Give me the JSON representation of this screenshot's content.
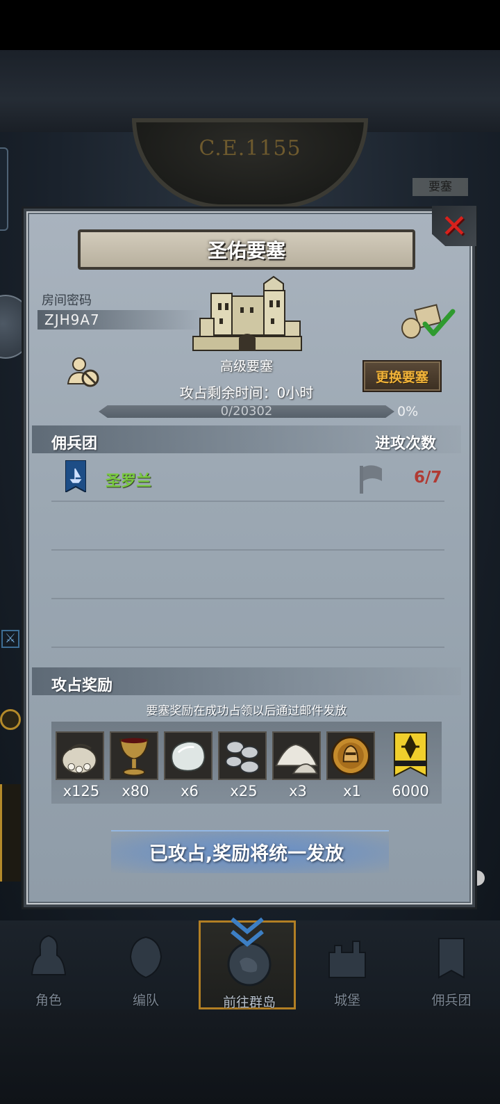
{
  "background": {
    "era": "C.E.1155",
    "map_label": "要塞"
  },
  "panel": {
    "title": "圣佑要塞",
    "room_code_label": "房间密码",
    "room_code": "ZJH9A7",
    "fortress_type": "高级要塞",
    "change_button": "更换要塞",
    "remaining_time": "攻占剩余时间：0小时",
    "progress": {
      "text": "0/20302",
      "percent_label": "0%",
      "value": 0
    }
  },
  "mercenary": {
    "header": "佣兵团",
    "attack_header": "进攻次数",
    "rows": [
      {
        "name": "圣罗兰",
        "attacks": "6/7"
      }
    ]
  },
  "rewards": {
    "header": "攻占奖励",
    "note": "要塞奖励在成功占领以后通过邮件发放",
    "items": [
      {
        "icon": "coin-sack-icon",
        "qty": "x125"
      },
      {
        "icon": "goblet-icon",
        "qty": "x80"
      },
      {
        "icon": "gem-stone-icon",
        "qty": "x6"
      },
      {
        "icon": "silver-ore-icon",
        "qty": "x25"
      },
      {
        "icon": "salt-pile-icon",
        "qty": "x3"
      },
      {
        "icon": "knight-medal-icon",
        "qty": "x1"
      },
      {
        "icon": "honor-banner-icon",
        "qty": "6000"
      }
    ],
    "status": "已攻占,奖励将统一发放"
  },
  "nav": {
    "items": [
      {
        "label": "角色",
        "icon": "character-icon"
      },
      {
        "label": "编队",
        "icon": "formation-icon"
      },
      {
        "label": "前往群岛",
        "icon": "islands-icon",
        "active": true
      },
      {
        "label": "城堡",
        "icon": "castle-icon"
      },
      {
        "label": "佣兵团",
        "icon": "mercenary-icon"
      }
    ]
  },
  "colors": {
    "guild_name": "#79c93f",
    "attack_count": "#b03a33",
    "change_button_text": "#f1b339",
    "close_x": "#d8211c",
    "nav_active_border": "#b27f24"
  }
}
